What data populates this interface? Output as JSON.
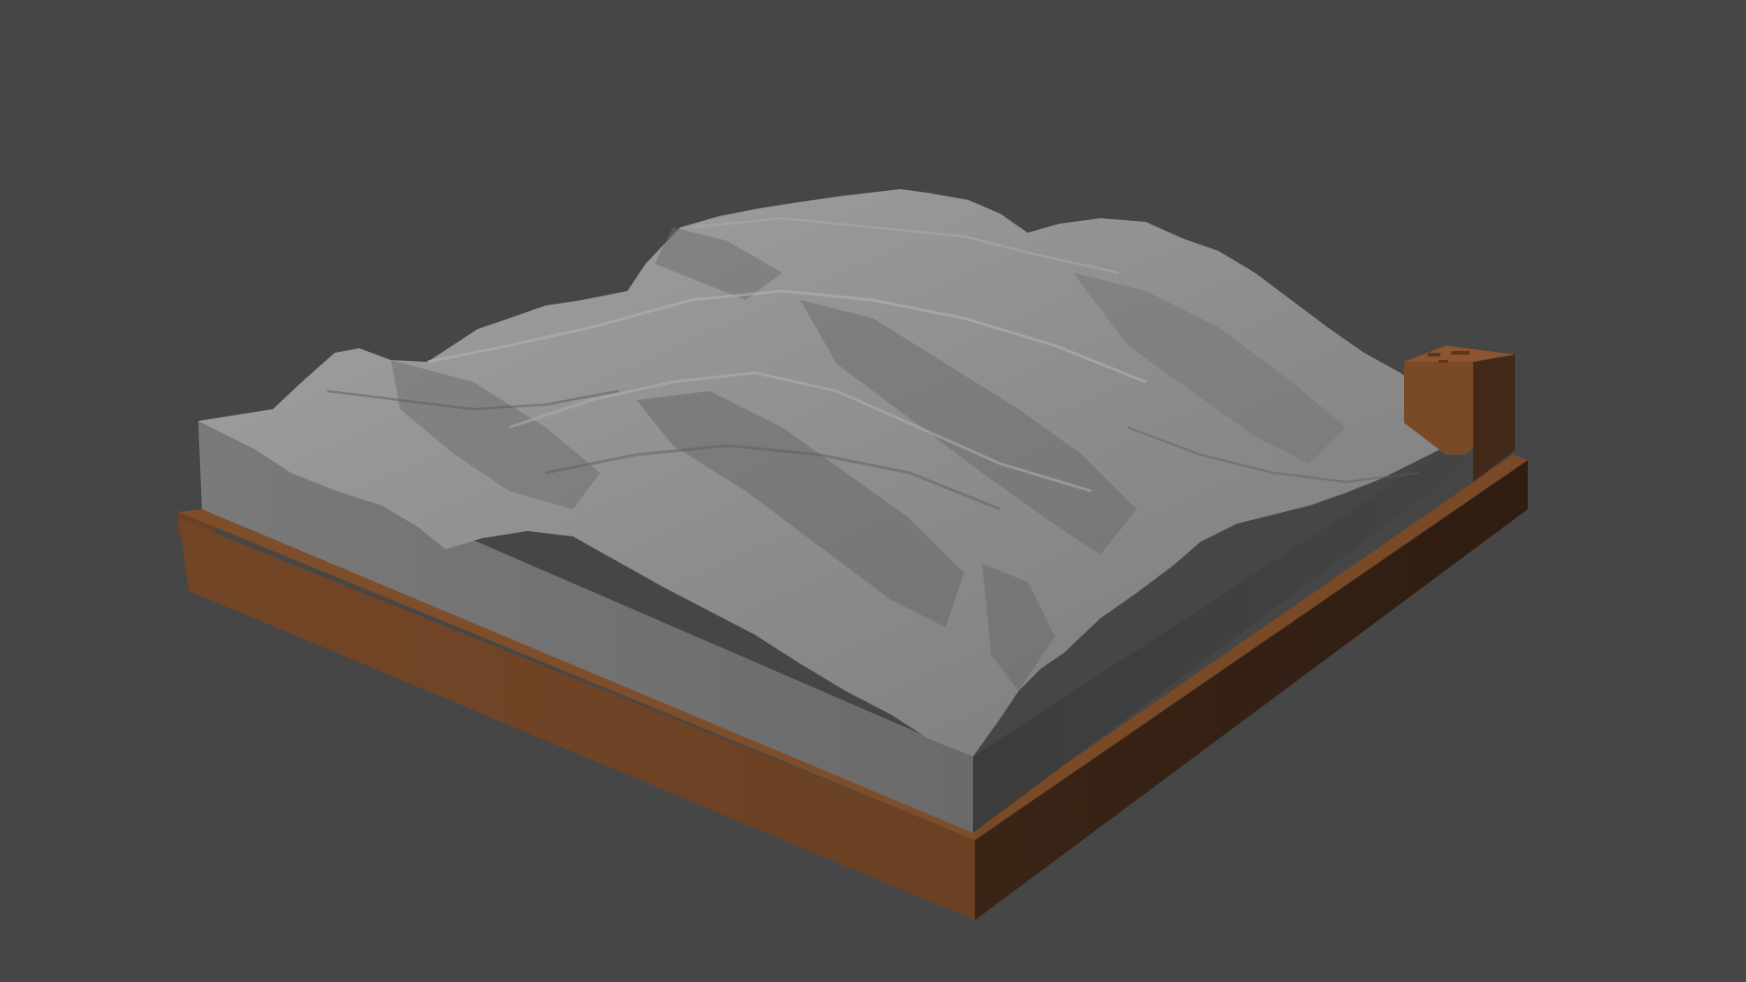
{
  "viewport": {
    "background_color": "#464646"
  },
  "scene": {
    "colors": {
      "terrain_light": "#9a9a9a",
      "terrain_mid": "#7d7d7d",
      "terrain_shadow": "#5d5d5d",
      "block_front": "#6b6b6b",
      "block_left_side": "#727272",
      "block_right_side": "#3e3e3e",
      "frame_front": "#6f4424",
      "frame_top": "#7e4d29",
      "frame_dark": "#3a2416",
      "tag_front": "#7a4a26",
      "tag_side": "#432918"
    }
  }
}
